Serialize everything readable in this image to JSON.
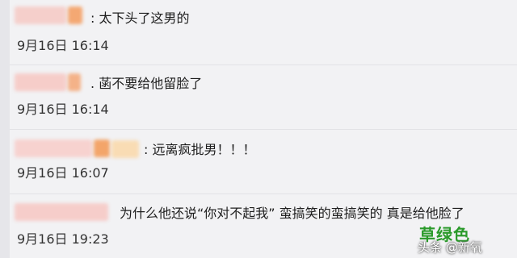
{
  "comments": [
    {
      "prefix": ":",
      "text": "太下头了这男的",
      "time": "9月16日 16:14"
    },
    {
      "prefix": ".",
      "text": "菡不要给他留脸了",
      "time": "9月16日 16:14"
    },
    {
      "prefix": ":",
      "text": "远离疯批男！！！",
      "time": "9月16日 16:07"
    },
    {
      "prefix": "",
      "text": "为什么他还说“你对不起我” 蛮搞笑的蛮搞笑的 真是给他脸了",
      "time": "9月16日 19:23"
    }
  ],
  "watermark": {
    "green_label": "草绿色",
    "source_label": "头条 @新氧"
  },
  "colors": {
    "blur_pink": "#f6c8c4",
    "blur_orange": "#f3a76a",
    "watermark_green": "#2a9a2a"
  }
}
